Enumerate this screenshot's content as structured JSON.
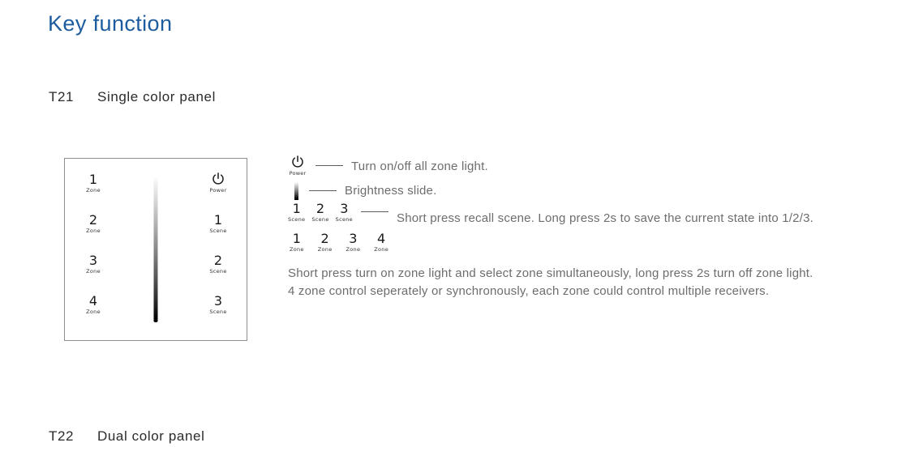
{
  "page": {
    "title": "Key function",
    "title_color": "#1d5c9e",
    "body_text_color": "#6d6d6d",
    "heading_color": "#2b2b2b"
  },
  "sections": [
    {
      "code": "T21",
      "name": "Single color panel"
    },
    {
      "code": "T22",
      "name": "Dual color panel"
    }
  ],
  "panel": {
    "left_keys": [
      {
        "num": "1",
        "sub": "Zone"
      },
      {
        "num": "2",
        "sub": "Zone"
      },
      {
        "num": "3",
        "sub": "Zone"
      },
      {
        "num": "4",
        "sub": "Zone"
      }
    ],
    "right_keys": [
      {
        "icon": "power-icon",
        "num": "",
        "sub": "Power"
      },
      {
        "num": "1",
        "sub": "Scene"
      },
      {
        "num": "2",
        "sub": "Scene"
      },
      {
        "num": "3",
        "sub": "Scene"
      }
    ],
    "slider": {
      "name": "brightness-slider",
      "gradient_from": "#ffffff",
      "gradient_to": "#000000"
    },
    "border_color": "#8e8e8e"
  },
  "legend": {
    "power": {
      "icon": "power-icon",
      "sub": "Power",
      "description": "Turn on/off all zone light."
    },
    "brightness": {
      "icon": "brightness-slider-icon",
      "description": "Brightness slide."
    },
    "scene": {
      "keys": [
        {
          "num": "1",
          "sub": "Scene"
        },
        {
          "num": "2",
          "sub": "Scene"
        },
        {
          "num": "3",
          "sub": "Scene"
        }
      ],
      "description": "Short press recall scene. Long press 2s to save the current state into 1/2/3."
    },
    "zone": {
      "keys": [
        {
          "num": "1",
          "sub": "Zone"
        },
        {
          "num": "2",
          "sub": "Zone"
        },
        {
          "num": "3",
          "sub": "Zone"
        },
        {
          "num": "4",
          "sub": "Zone"
        }
      ],
      "paragraph_line1": "Short press turn on zone light and select zone simultaneously, long press 2s turn off zone light.",
      "paragraph_line2": "4 zone control seperately or synchronously, each zone could control multiple receivers."
    }
  }
}
